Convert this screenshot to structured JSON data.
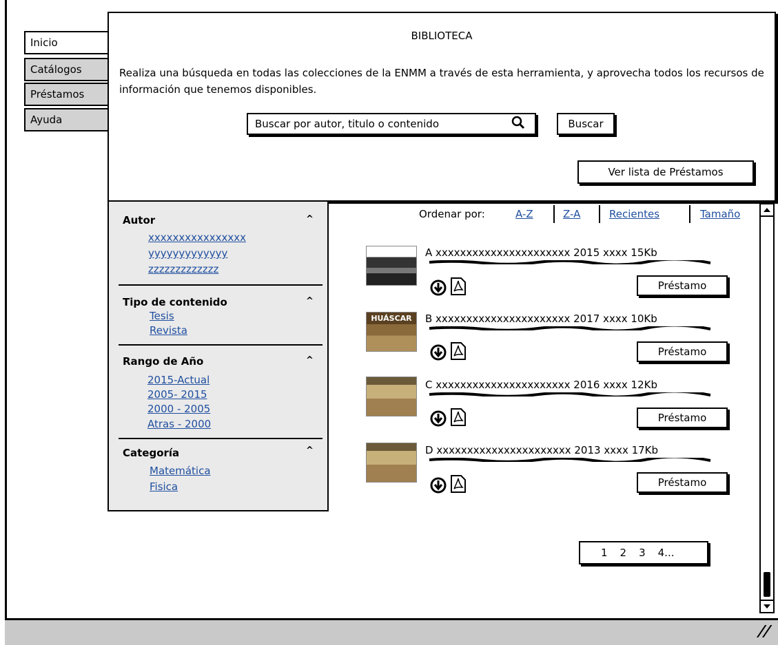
{
  "tabs": [
    {
      "label": "Inicio"
    },
    {
      "label": "Catálogos"
    },
    {
      "label": "Préstamos"
    },
    {
      "label": "Ayuda"
    }
  ],
  "header": {
    "title": "BIBLIOTECA",
    "description": "Realiza una búsqueda en todas las colecciones de la ENMM a través de esta herramienta, y aprovecha todos los recursos de información que tenemos disponibles."
  },
  "search": {
    "placeholder": "Buscar por autor, titulo o contenido",
    "button": "Buscar"
  },
  "loans_button": "Ver lista de Préstamos",
  "filters": [
    {
      "title": "Autor",
      "collapse": "^",
      "items": [
        "xxxxxxxxxxxxxxxx",
        "yyyyyyyyyyyyy",
        "zzzzzzzzzzzzz"
      ]
    },
    {
      "title": "Tipo de contenido",
      "collapse": "^",
      "items": [
        "Tesis",
        "Revista"
      ]
    },
    {
      "title": "Rango de Año",
      "collapse": "^",
      "items": [
        "2015-Actual",
        "2005- 2015",
        "2000 - 2005",
        "Atras - 2000"
      ]
    },
    {
      "title": "Categoría",
      "collapse": "^",
      "items": [
        "Matemática",
        "Fisica"
      ]
    }
  ],
  "sort": {
    "label": "Ordenar por:",
    "options": [
      "A-Z",
      "Z-A",
      "Recientes",
      "Tamaño"
    ]
  },
  "results": [
    {
      "text": "A xxxxxxxxxxxxxxxxxxxxxx 2015 xxxx 15Kb",
      "button": "Préstamo",
      "thumb": "dark-cover"
    },
    {
      "text": "B xxxxxxxxxxxxxxxxxxxxxx 2017 xxxx 10Kb",
      "button": "Préstamo",
      "thumb": "huascar-cover"
    },
    {
      "text": "C xxxxxxxxxxxxxxxxxxxxxx 2016 xxxx 12Kb",
      "button": "Préstamo",
      "thumb": "battle-cover"
    },
    {
      "text": "D xxxxxxxxxxxxxxxxxxxxxx 2013 xxxx 17Kb",
      "button": "Préstamo",
      "thumb": "battle-cover"
    }
  ],
  "thumb_text": {
    "huascar": "HUÁSCAR"
  },
  "pagination": [
    "1",
    "2",
    "3",
    "4..."
  ],
  "icons": {
    "download": "download-circle-icon",
    "pdf": "pdf-icon",
    "search": "search-icon"
  },
  "colors": {
    "link": "#1f4fa0",
    "panel": "#eaeaea",
    "tab": "#d2d2d2"
  }
}
